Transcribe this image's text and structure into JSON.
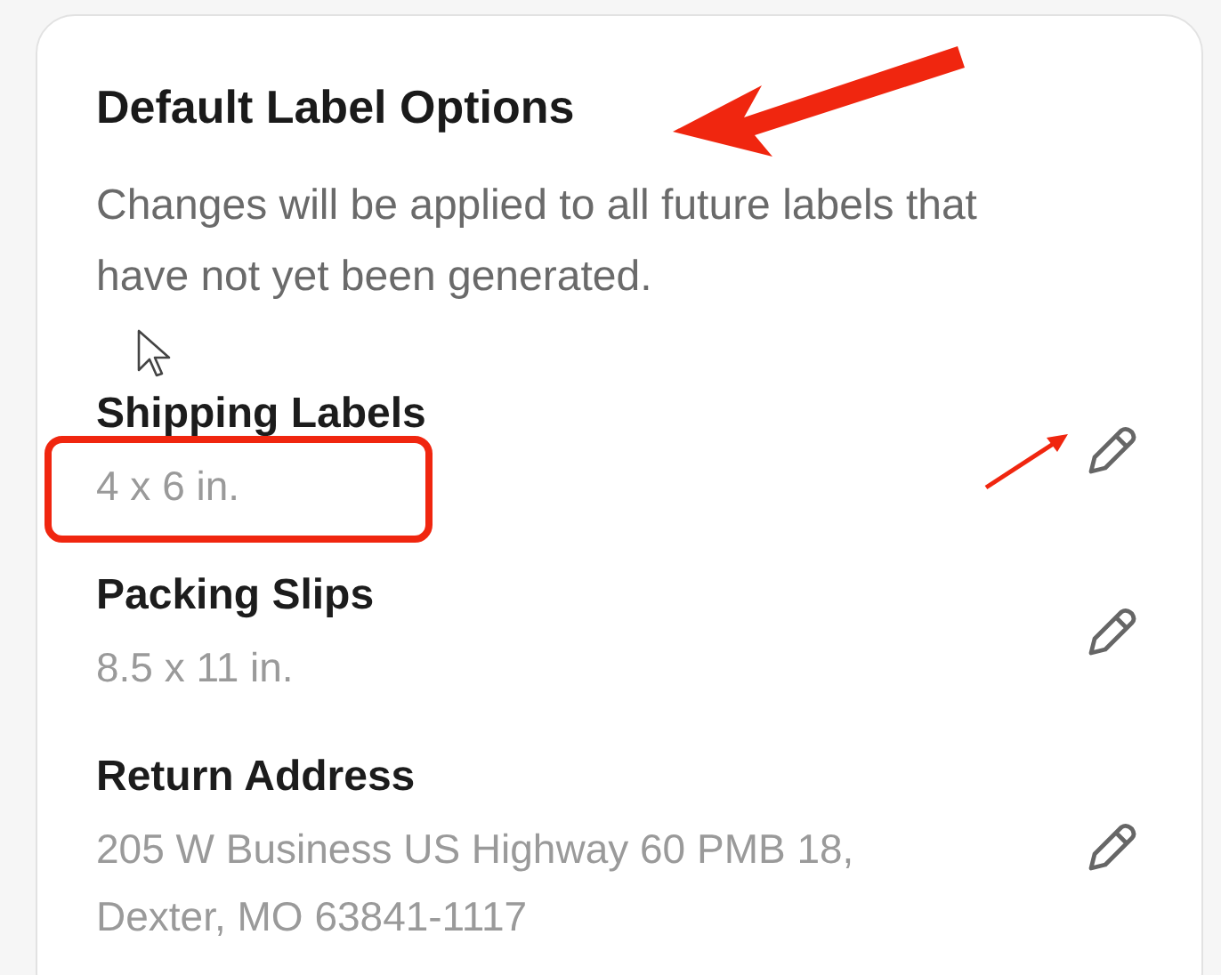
{
  "card": {
    "title": "Default Label Options",
    "description": "Changes will be applied to all future labels that have not yet been generated.",
    "options": [
      {
        "name": "Shipping Labels",
        "value": "4 x 6 in."
      },
      {
        "name": "Packing Slips",
        "value": "8.5 x 11 in."
      },
      {
        "name": "Return Address",
        "value": "205 W Business US Highway 60 PMB 18, Dexter, MO 63841-1117"
      }
    ]
  }
}
